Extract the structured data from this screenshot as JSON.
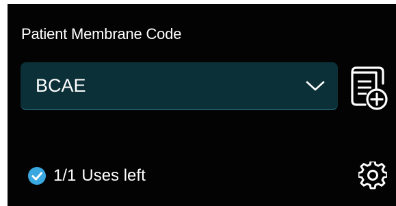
{
  "field": {
    "label": "Patient Membrane Code",
    "selected_value": "BCAE"
  },
  "icons": {
    "dropdown": "chevron-down-icon",
    "add_code": "document-add-icon",
    "status": "check-circle-icon",
    "settings": "gear-icon"
  },
  "status": {
    "count": "1/1",
    "text": "Uses left"
  },
  "colors": {
    "panel_background": "#030303",
    "field_background": "#0b3038",
    "check_accent": "#3aa8e0",
    "text": "#ffffff"
  }
}
